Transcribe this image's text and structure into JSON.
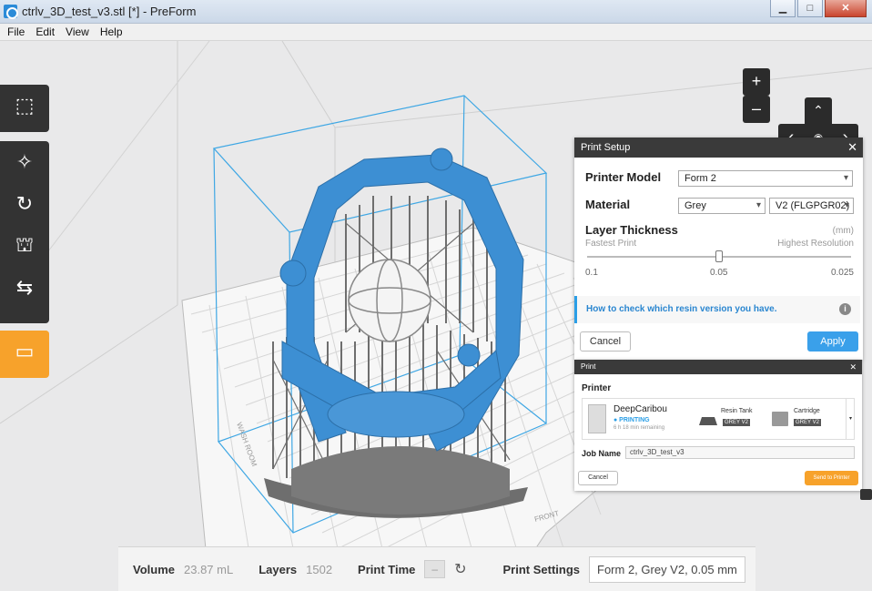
{
  "window": {
    "title": "ctrlv_3D_test_v3.stl [*] - PreForm",
    "min": "▁",
    "max": "□",
    "close": "✕"
  },
  "menu": [
    "File",
    "Edit",
    "View",
    "Help"
  ],
  "nav": {
    "zoom_in": "+",
    "zoom_out": "–",
    "up": "⌃",
    "down": "⌄",
    "left": "‹",
    "right": "›"
  },
  "print_setup": {
    "title": "Print Setup",
    "close": "✕",
    "printer_model_label": "Printer Model",
    "printer_model_value": "Form 2",
    "material_label": "Material",
    "material_value": "Grey",
    "material_version": "V2 (FLGPGR02)",
    "layer_label": "Layer Thickness",
    "layer_unit": "(mm)",
    "fastest": "Fastest Print",
    "highest": "Highest Resolution",
    "ticks": [
      "0.1",
      "0.05",
      "0.025"
    ],
    "slider_value_fraction": 0.5,
    "info_link": "How to check which resin version you have.",
    "info_icon": "i",
    "cancel": "Cancel",
    "apply": "Apply"
  },
  "print_dialog": {
    "title": "Print",
    "close": "✕",
    "printer_label": "Printer",
    "printer_name": "DeepCaribou",
    "status": "● PRINTING",
    "remaining": "6 h 18 min remaining",
    "resin_tank_label": "Resin Tank",
    "resin_tank_badge": "GREY V2",
    "cartridge_label": "Cartridge",
    "cartridge_badge": "GREY V2",
    "job_name_label": "Job Name",
    "job_name_value": "ctrlv_3D_test_v3",
    "cancel": "Cancel",
    "send": "Send to Printer"
  },
  "bed_labels": {
    "front": "FRONT",
    "side": "WASH ROOM"
  },
  "status": {
    "volume_label": "Volume",
    "volume_value": "23.87 mL",
    "layers_label": "Layers",
    "layers_value": "1502",
    "print_time_label": "Print Time",
    "print_time_value": "–",
    "print_settings_label": "Print Settings",
    "print_settings_value": "Form 2, Grey V2, 0.05 mm"
  },
  "colors": {
    "accent": "#2a9ee6",
    "orange": "#f7a22b",
    "model": "#3d8fd3",
    "support": "#707070"
  }
}
